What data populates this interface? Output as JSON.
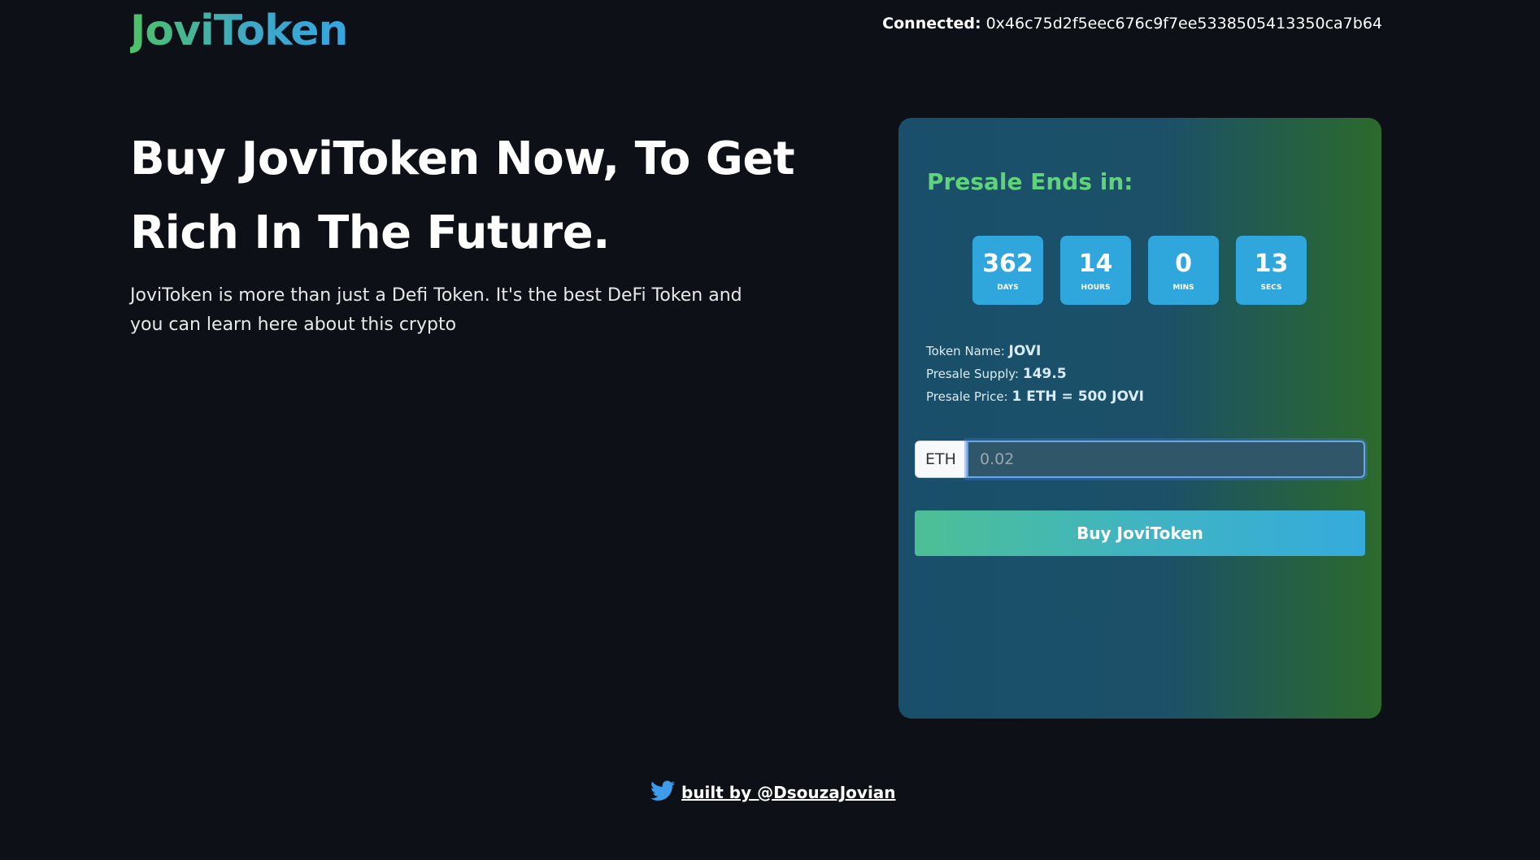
{
  "header": {
    "logo": "JoviToken",
    "connected_label": "Connected:",
    "wallet_address": "0x46c75d2f5eec676c9f7ee5338505413350ca7b64"
  },
  "hero": {
    "title": "Buy JoviToken Now, To Get Rich In The Future.",
    "description": "JoviToken is more than just a Defi Token. It's the best DeFi Token and you can learn here about this crypto"
  },
  "presale": {
    "title": "Presale Ends in:",
    "countdown": [
      {
        "value": "362",
        "unit": "DAYS"
      },
      {
        "value": "14",
        "unit": "HOURS"
      },
      {
        "value": "0",
        "unit": "MINS"
      },
      {
        "value": "13",
        "unit": "SECS"
      }
    ],
    "info": {
      "token_name_label": "Token Name:",
      "token_name": "JOVI",
      "supply_label": "Presale Supply:",
      "supply": "149.5",
      "price_label": "Presale Price:",
      "price": "1 ETH = 500 JOVI"
    },
    "input": {
      "prefix": "ETH",
      "placeholder": "0.02"
    },
    "buy_button": "Buy JoviToken"
  },
  "footer": {
    "link_text": "built by @DsouzaJovian",
    "icon": "twitter-icon"
  },
  "colors": {
    "background": "#0d1117",
    "accent_green": "#5fd27a",
    "accent_blue": "#2fa6dc"
  }
}
